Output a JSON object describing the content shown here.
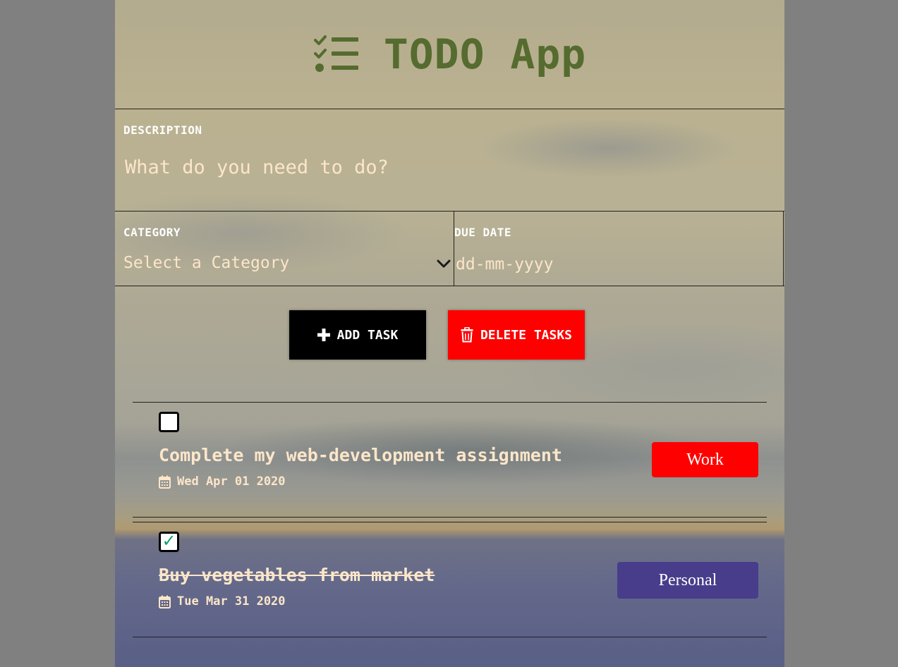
{
  "header": {
    "title": "TODO App",
    "icon": "list-check-icon",
    "title_color": "#556b2f"
  },
  "form": {
    "description_label": "DESCRIPTION",
    "description_placeholder": "What do you need to do?",
    "description_value": "",
    "category_label": "CATEGORY",
    "category_value": "Select a Category",
    "due_date_label": "DUE DATE",
    "due_date_placeholder": "dd-mm-yyyy"
  },
  "buttons": {
    "add_label": "ADD TASK",
    "add_icon": "plus-icon",
    "delete_label": "DELETE TASKS",
    "delete_icon": "trash-icon",
    "add_color": "#000000",
    "delete_color": "#ff0000"
  },
  "tasks": [
    {
      "checked": false,
      "title": "Complete my web-development assignment",
      "date": "Wed Apr 01 2020",
      "category": "Work",
      "category_color": "#ff0000"
    },
    {
      "checked": true,
      "title": "Buy vegetables from market",
      "date": "Tue Mar 31 2020",
      "category": "Personal",
      "category_color": "#483d8b"
    }
  ],
  "colors": {
    "text_accent": "#fce6c9",
    "page_background": "#808080"
  }
}
